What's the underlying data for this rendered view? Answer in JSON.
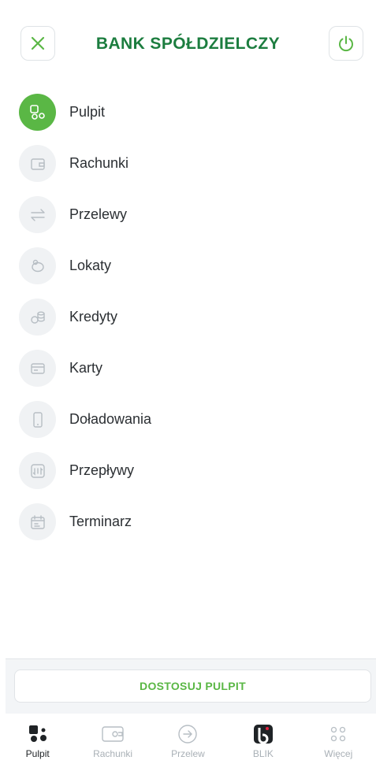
{
  "header": {
    "title": "BANK SPÓŁDZIELCZY",
    "close_icon": "close-icon",
    "power_icon": "power-icon",
    "accent": "#5ab745",
    "title_color": "#1c7d3f"
  },
  "menu": {
    "items": [
      {
        "label": "Pulpit",
        "icon": "dashboard-icon",
        "active": true
      },
      {
        "label": "Rachunki",
        "icon": "wallet-icon",
        "active": false
      },
      {
        "label": "Przelewy",
        "icon": "transfer-arrows-icon",
        "active": false
      },
      {
        "label": "Lokaty",
        "icon": "piggy-bank-icon",
        "active": false
      },
      {
        "label": "Kredyty",
        "icon": "coins-icon",
        "active": false
      },
      {
        "label": "Karty",
        "icon": "card-icon",
        "active": false
      },
      {
        "label": "Doładowania",
        "icon": "phone-icon",
        "active": false
      },
      {
        "label": "Przepływy",
        "icon": "cashflow-icon",
        "active": false
      },
      {
        "label": "Terminarz",
        "icon": "calendar-icon",
        "active": false
      }
    ]
  },
  "customize": {
    "label": "DOSTOSUJ PULPIT"
  },
  "tabbar": {
    "tabs": [
      {
        "label": "Pulpit",
        "icon": "dashboard-icon",
        "active": true
      },
      {
        "label": "Rachunki",
        "icon": "wallet-icon",
        "active": false
      },
      {
        "label": "Przelew",
        "icon": "arrow-right-circle-icon",
        "active": false
      },
      {
        "label": "BLIK",
        "icon": "blik-icon",
        "active": false
      },
      {
        "label": "Więcej",
        "icon": "more-dots-icon",
        "active": false
      }
    ]
  }
}
